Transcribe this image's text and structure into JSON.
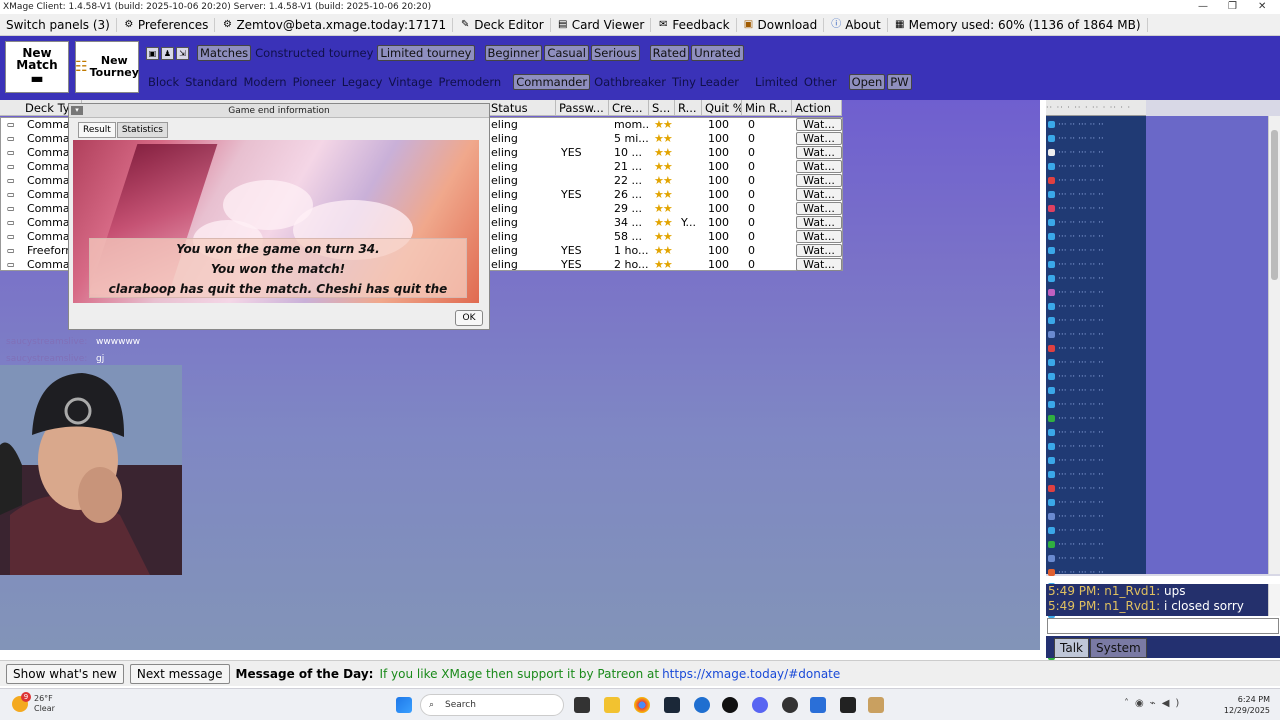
{
  "window": {
    "title": "XMage  Client: 1.4.58-V1 (build: 2025-10-06 20:20)  Server: 1.4.58-V1 (build: 2025-10-06 20:20)",
    "min": "—",
    "max": "❐",
    "close": "✕"
  },
  "menu": [
    {
      "label": "Switch panels (3)",
      "icon": ""
    },
    {
      "label": "Preferences",
      "icon": "gear-icon"
    },
    {
      "label": "Zemtov@beta.xmage.today:17171",
      "icon": "connect-icon"
    },
    {
      "label": "Deck Editor",
      "icon": "deck-icon"
    },
    {
      "label": "Card Viewer",
      "icon": "card-icon"
    },
    {
      "label": "Feedback",
      "icon": "feedback-icon"
    },
    {
      "label": "Download",
      "icon": "download-icon"
    },
    {
      "label": "About",
      "icon": "info-icon"
    },
    {
      "label": "Memory used: 60% (1136 of 1864 MB)",
      "icon": "memory-icon"
    }
  ],
  "buttons": {
    "new_match_line1": "New",
    "new_match_line2": "Match",
    "new_tourney_line1": "New",
    "new_tourney_line2": "Tourney"
  },
  "filters_row1": [
    {
      "label": "Matches",
      "on": true
    },
    {
      "label": "Constructed tourney",
      "on": false
    },
    {
      "label": "Limited tourney",
      "on": true
    },
    {
      "label": "Beginner",
      "on": true
    },
    {
      "label": "Casual",
      "on": true
    },
    {
      "label": "Serious",
      "on": true
    },
    {
      "label": "Rated",
      "on": true
    },
    {
      "label": "Unrated",
      "on": true
    }
  ],
  "filters_row2": [
    {
      "label": "Block",
      "on": false
    },
    {
      "label": "Standard",
      "on": false
    },
    {
      "label": "Modern",
      "on": false
    },
    {
      "label": "Pioneer",
      "on": false
    },
    {
      "label": "Legacy",
      "on": false
    },
    {
      "label": "Vintage",
      "on": false
    },
    {
      "label": "Premodern",
      "on": false
    },
    {
      "label": "Commander",
      "on": true
    },
    {
      "label": "Oathbreaker",
      "on": false
    },
    {
      "label": "Tiny Leader",
      "on": false
    },
    {
      "label": "Limited",
      "on": false
    },
    {
      "label": "Other",
      "on": false
    },
    {
      "label": "Open",
      "on": true
    },
    {
      "label": "PW",
      "on": true
    }
  ],
  "table": {
    "headers": [
      "Deck Ty...",
      "Status",
      "Passw...",
      "Cre...",
      "S...",
      "R...",
      "Quit %",
      "Min R...",
      "Action"
    ],
    "rows": [
      {
        "deck": "Commar",
        "status": "eling",
        "pw": "",
        "created": "mom...",
        "r": "",
        "quit": "100",
        "min": "0",
        "action": "Wat..."
      },
      {
        "deck": "Commar",
        "status": "eling",
        "pw": "",
        "created": "5 mi...",
        "r": "",
        "quit": "100",
        "min": "0",
        "action": "Wat..."
      },
      {
        "deck": "Commar",
        "status": "eling",
        "pw": "YES",
        "created": "10 ...",
        "r": "",
        "quit": "100",
        "min": "0",
        "action": "Wat..."
      },
      {
        "deck": "Commar",
        "status": "eling",
        "pw": "",
        "created": "21 ...",
        "r": "",
        "quit": "100",
        "min": "0",
        "action": "Wat..."
      },
      {
        "deck": "Commar",
        "status": "eling",
        "pw": "",
        "created": "22 ...",
        "r": "",
        "quit": "100",
        "min": "0",
        "action": "Wat..."
      },
      {
        "deck": "Commar",
        "status": "eling",
        "pw": "YES",
        "created": "26 ...",
        "r": "",
        "quit": "100",
        "min": "0",
        "action": "Wat..."
      },
      {
        "deck": "Commar",
        "status": "eling",
        "pw": "",
        "created": "29 ...",
        "r": "",
        "quit": "100",
        "min": "0",
        "action": "Wat..."
      },
      {
        "deck": "Commar",
        "status": "eling",
        "pw": "",
        "created": "34 ...",
        "r": "Y...",
        "quit": "100",
        "min": "0",
        "action": "Wat..."
      },
      {
        "deck": "Commar",
        "status": "eling",
        "pw": "",
        "created": "58 ...",
        "r": "",
        "quit": "100",
        "min": "0",
        "action": "Wat..."
      },
      {
        "deck": "Freeforr",
        "status": "eling",
        "pw": "YES",
        "created": "1 ho...",
        "r": "",
        "quit": "100",
        "min": "0",
        "action": "Wat..."
      },
      {
        "deck": "Commar",
        "status": "eling",
        "pw": "YES",
        "created": "2 ho...",
        "r": "",
        "quit": "100",
        "min": "0",
        "action": "Wat..."
      }
    ]
  },
  "dialog": {
    "title": "Game end information",
    "tab_result": "Result",
    "tab_statistics": "Statistics",
    "line1": "You won the game on turn 34.",
    "line2": "You won the match!",
    "line3": "claraboop has quit the match. Cheshi has quit the match.",
    "ok": "OK"
  },
  "chat": [
    {
      "user": "saucystreamslive:",
      "msg": "wwwwww"
    },
    {
      "user": "saucystreamslive:",
      "msg": "gj"
    }
  ],
  "talk": {
    "lines": [
      {
        "time": "5:49 PM:",
        "name": "n1_Rvd1:",
        "msg": "ups"
      },
      {
        "time": "5:49 PM:",
        "name": "n1_Rvd1:",
        "msg": "i closed sorry"
      }
    ],
    "tab_talk": "Talk",
    "tab_system": "System"
  },
  "motd": {
    "show_whats_new": "Show what's new",
    "next_message": "Next message",
    "label": "Message of the Day:",
    "text": "If you like XMage then support it by Patreon at",
    "link": "https://xmage.today/#donate"
  },
  "taskbar": {
    "weather_temp": "26°F",
    "weather_cond": "Clear",
    "weather_badge": "9",
    "search": "Search",
    "time": "6:24 PM",
    "date": "12/29/2025"
  }
}
